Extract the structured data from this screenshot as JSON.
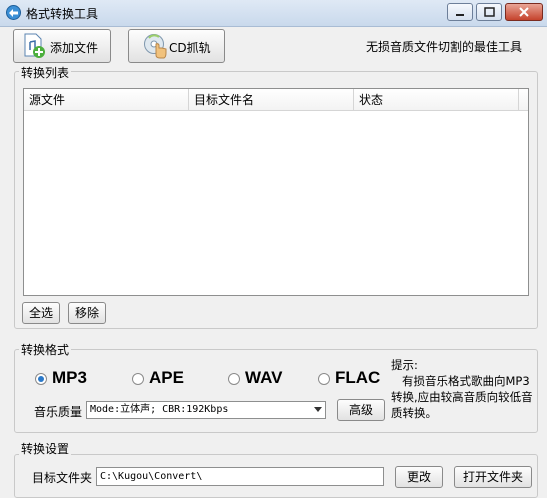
{
  "window": {
    "title": "格式转换工具"
  },
  "toolbar": {
    "add_file_label": "添加文件",
    "add_file_icon": "add-file-icon",
    "cd_rip_label": "CD抓轨",
    "cd_rip_icon": "cd-hand-icon",
    "tagline": "无损音质文件切割的最佳工具"
  },
  "convert_list": {
    "group_title": "转换列表",
    "columns": [
      "源文件",
      "目标文件名",
      "状态"
    ],
    "rows": [],
    "select_all_label": "全选",
    "remove_label": "移除"
  },
  "format": {
    "group_title": "转换格式",
    "options": [
      {
        "label": "MP3",
        "selected": true
      },
      {
        "label": "APE",
        "selected": false
      },
      {
        "label": "WAV",
        "selected": false
      },
      {
        "label": "FLAC",
        "selected": false
      }
    ],
    "quality_label": "音乐质量",
    "quality_value": "Mode:立体声; CBR:192Kbps",
    "advanced_label": "高级",
    "tip_title": "提示:",
    "tip_body": "有损音乐格式歌曲向MP3转换,应由较高音质向较低音质转换。"
  },
  "settings": {
    "group_title": "转换设置",
    "target_folder_label": "目标文件夹",
    "target_folder_value": "C:\\Kugou\\Convert\\",
    "change_label": "更改",
    "open_folder_label": "打开文件夹"
  },
  "colors": {
    "accent": "#2b79c9",
    "title_bar": "#c9d9ec",
    "close_button": "#c5432c"
  }
}
